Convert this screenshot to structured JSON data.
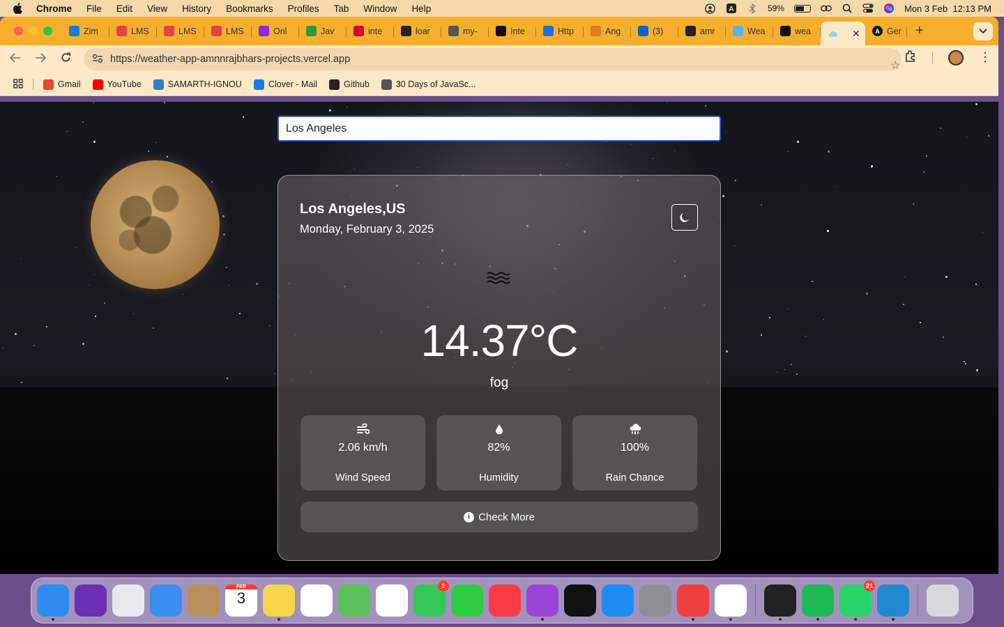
{
  "menubar": {
    "app": "Chrome",
    "items": [
      "File",
      "Edit",
      "View",
      "History",
      "Bookmarks",
      "Profiles",
      "Tab",
      "Window",
      "Help"
    ],
    "battery": "59%",
    "clock": "Mon 3 Feb  12:13 PM"
  },
  "tabs": [
    {
      "title": "Zim",
      "icon": "zimbra-icon",
      "color": "#1b7bd6"
    },
    {
      "title": "LMS",
      "icon": "figma-icon",
      "color": "#e2453b"
    },
    {
      "title": "LMS",
      "icon": "figma-icon",
      "color": "#e2453b"
    },
    {
      "title": "LMS",
      "icon": "figma-icon",
      "color": "#e2453b"
    },
    {
      "title": "Onl",
      "icon": "pen-icon",
      "color": "#8a2be2"
    },
    {
      "title": "Jav",
      "icon": "infinity-icon",
      "color": "#2f9a3a"
    },
    {
      "title": "inte",
      "icon": "angular-icon",
      "color": "#dd0031"
    },
    {
      "title": "loar",
      "icon": "github-icon",
      "color": "#222222"
    },
    {
      "title": "my-",
      "icon": "globe-icon",
      "color": "#555555"
    },
    {
      "title": "Inte",
      "icon": "a-icon",
      "color": "#111111"
    },
    {
      "title": "Http",
      "icon": "bolt-icon",
      "color": "#1e6fe0"
    },
    {
      "title": "Ang",
      "icon": "flame-icon",
      "color": "#e07b1e"
    },
    {
      "title": "(3)",
      "icon": "linkedin-icon",
      "color": "#0a66c2"
    },
    {
      "title": "amr",
      "icon": "github-icon",
      "color": "#222222"
    },
    {
      "title": "Wea",
      "icon": "cloud-icon",
      "color": "#5ab3e6"
    },
    {
      "title": "wea",
      "icon": "vercel-icon",
      "color": "#111111"
    }
  ],
  "active_tab": {
    "title": "",
    "icon": "cloud-icon"
  },
  "last_tab": {
    "title": "Ger",
    "icon": "a-icon"
  },
  "address": {
    "url": "https://weather-app-amnnrajbhars-projects.vercel.app"
  },
  "bookmarks": [
    {
      "label": "Gmail",
      "icon": "gmail-icon",
      "color": "#ea4335"
    },
    {
      "label": "YouTube",
      "icon": "youtube-icon",
      "color": "#ff0000"
    },
    {
      "label": "SAMARTH-IGNOU",
      "icon": "samarth-icon",
      "color": "#2a7fcf"
    },
    {
      "label": "Clover - Mail",
      "icon": "zimbra-icon",
      "color": "#1b7bd6"
    },
    {
      "label": "Github",
      "icon": "github-icon",
      "color": "#222222"
    },
    {
      "label": "30 Days of JavaSc...",
      "icon": "bookmark-icon",
      "color": "#555555"
    }
  ],
  "weather": {
    "search_value": "Los Angeles",
    "location": "Los Angeles,US",
    "date": "Monday, February 3, 2025",
    "temperature": "14.37°C",
    "condition": "fog",
    "stats": [
      {
        "value": "2.06 km/h",
        "label": "Wind Speed",
        "icon": "wind-icon"
      },
      {
        "value": "82%",
        "label": "Humidity",
        "icon": "droplet-icon"
      },
      {
        "value": "100%",
        "label": "Rain Chance",
        "icon": "cloud-rain-icon"
      }
    ],
    "more_label": "Check More"
  },
  "dock": [
    {
      "name": "finder",
      "color": "#2d8cf0"
    },
    {
      "name": "siri",
      "color": "#6b2fb3"
    },
    {
      "name": "launchpad",
      "color": "#e8e8ee"
    },
    {
      "name": "mail",
      "color": "#3a8ff0"
    },
    {
      "name": "contacts",
      "color": "#b8915a"
    },
    {
      "name": "calendar",
      "color": "#ffffff"
    },
    {
      "name": "notes",
      "color": "#f7d54b"
    },
    {
      "name": "reminders",
      "color": "#ffffff"
    },
    {
      "name": "maps",
      "color": "#5cc15a"
    },
    {
      "name": "photos",
      "color": "#ffffff"
    },
    {
      "name": "messages",
      "color": "#34c759"
    },
    {
      "name": "facetime",
      "color": "#2ecc40"
    },
    {
      "name": "music",
      "color": "#fc3c44"
    },
    {
      "name": "podcasts",
      "color": "#9b45d6"
    },
    {
      "name": "apple-tv",
      "color": "#111111"
    },
    {
      "name": "app-store",
      "color": "#1c8ef2"
    },
    {
      "name": "system-settings",
      "color": "#8e8e93"
    },
    {
      "name": "anydesk",
      "color": "#ef3e3e"
    },
    {
      "name": "chrome",
      "color": "#ffffff"
    },
    {
      "name": "terminal",
      "color": "#222222"
    },
    {
      "name": "spotify",
      "color": "#1db954"
    },
    {
      "name": "whatsapp",
      "color": "#25d366"
    },
    {
      "name": "vscode",
      "color": "#1f8ad2"
    },
    {
      "name": "trash",
      "color": "#d8d8dc"
    }
  ],
  "dock_badges": {
    "messages": "1",
    "whatsapp": "21",
    "calendar_month": "FEB",
    "calendar_day": "3"
  }
}
